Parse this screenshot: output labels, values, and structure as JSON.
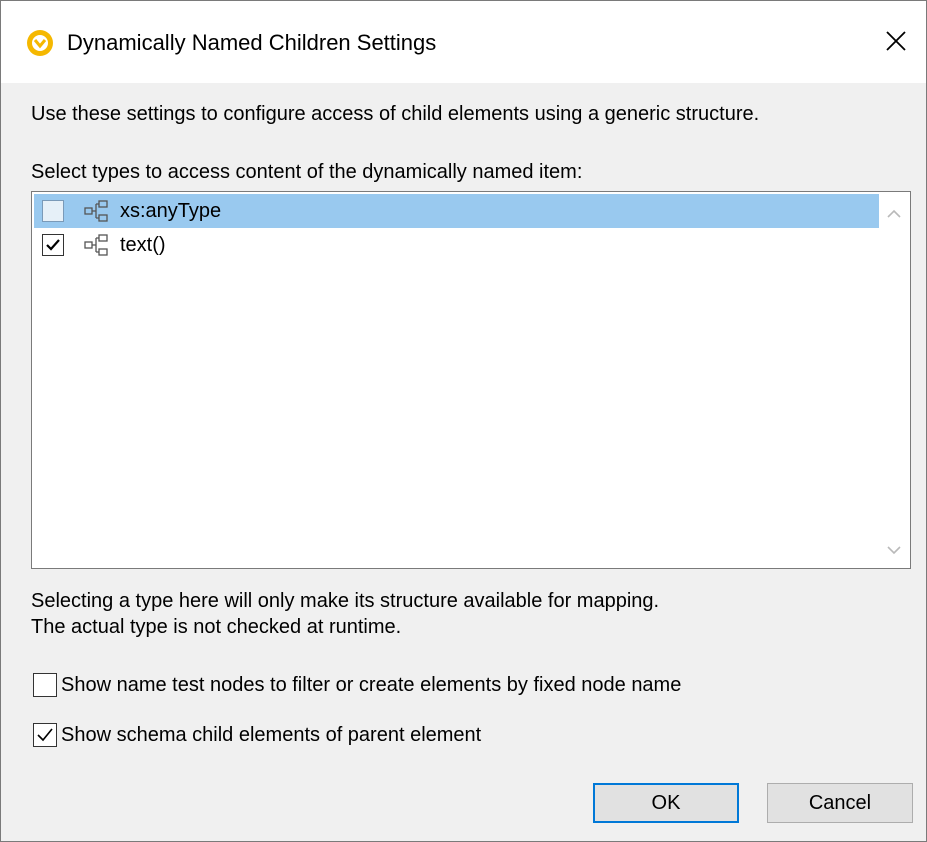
{
  "window": {
    "title": "Dynamically Named Children Settings",
    "icon": "altova-app-icon",
    "close_icon": "close-icon"
  },
  "intro_text": "Use these settings to configure access of child elements using a generic structure.",
  "list": {
    "label": "Select types to access content of the dynamically named item:",
    "items": [
      {
        "label": "xs:anyType",
        "checked": false,
        "selected": true,
        "icon": "element-tree-icon"
      },
      {
        "label": "text()",
        "checked": true,
        "selected": false,
        "icon": "element-tree-icon"
      }
    ]
  },
  "note": {
    "line1": "Selecting a type here will only make its structure available for mapping.",
    "line2": "The actual type is not checked at runtime."
  },
  "options": {
    "name_test": {
      "label": "Show name test nodes to filter or create elements by fixed node name",
      "checked": false
    },
    "schema_children": {
      "label": "Show schema child elements of parent element",
      "checked": true
    }
  },
  "buttons": {
    "ok": "OK",
    "cancel": "Cancel"
  },
  "colors": {
    "selection": "#99c9ef",
    "default_button_border": "#0078d7",
    "app_icon": "#f5b800"
  }
}
